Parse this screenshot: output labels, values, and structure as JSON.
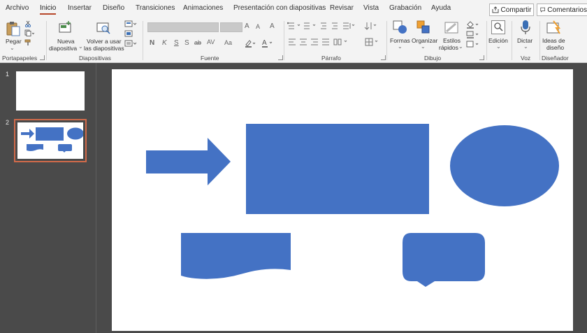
{
  "tabs": [
    {
      "label": "Archivo",
      "active": false
    },
    {
      "label": "Inicio",
      "active": true
    },
    {
      "label": "Insertar",
      "active": false
    },
    {
      "label": "Diseño",
      "active": false
    },
    {
      "label": "Transiciones",
      "active": false
    },
    {
      "label": "Animaciones",
      "active": false
    },
    {
      "label": "Presentación con diapositivas",
      "active": false
    },
    {
      "label": "Revisar",
      "active": false
    },
    {
      "label": "Vista",
      "active": false
    },
    {
      "label": "Grabación",
      "active": false
    },
    {
      "label": "Ayuda",
      "active": false
    }
  ],
  "share_label": "Compartir",
  "comments_label": "Comentarios",
  "groups": {
    "portapapeles": "Portapapeles",
    "diapositivas": "Diapositivas",
    "fuente": "Fuente",
    "parrafo": "Párrafo",
    "dibujo": "Dibujo",
    "voz": "Voz",
    "disenador": "Diseñador"
  },
  "buttons": {
    "pegar": "Pegar",
    "nueva_1": "Nueva",
    "nueva_2": "diapositiva",
    "volver_1": "Volver a usar",
    "volver_2": "las diapositivas",
    "formas": "Formas",
    "organizar": "Organizar",
    "estilos_1": "Estilos",
    "estilos_2": "rápidos",
    "edicion": "Edición",
    "dictar": "Dictar",
    "ideas_1": "Ideas de",
    "ideas_2": "diseño"
  },
  "font_controls": {
    "bold": "N",
    "italic": "K",
    "underline": "S",
    "strike": "S",
    "spacing": "ab",
    "char_spacing": "AV",
    "case": "Aa",
    "grow": "A",
    "shrink": "A",
    "clear": "A",
    "color": "A"
  },
  "slides": [
    {
      "number": "1"
    },
    {
      "number": "2",
      "selected": true
    }
  ],
  "colors": {
    "shape_fill": "#4472c4",
    "accent": "#b7472a",
    "selection": "#d06a4a"
  }
}
